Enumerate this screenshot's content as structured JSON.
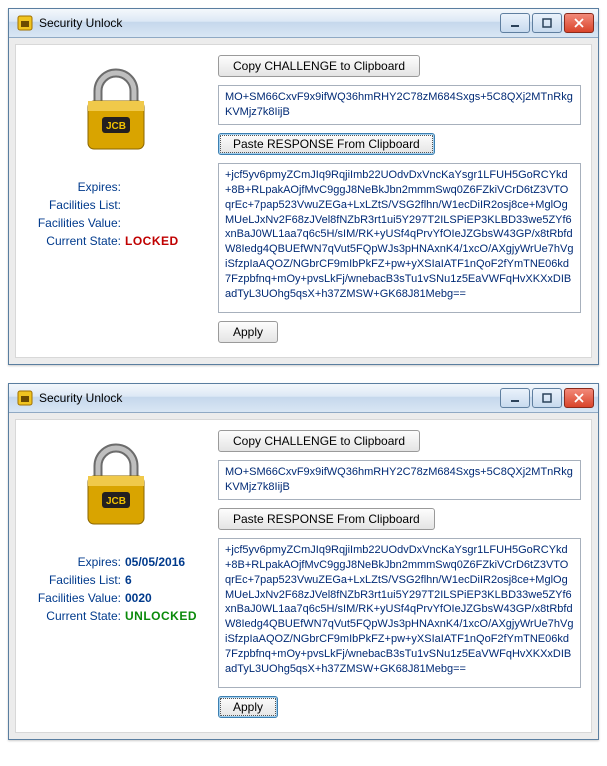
{
  "windows": [
    {
      "title": "Security Unlock",
      "copy_button": "Copy CHALLENGE to Clipboard",
      "paste_button": "Paste RESPONSE From Clipboard",
      "apply_button": "Apply",
      "challenge": "MO+SM66CxvF9x9ifWQ36hmRHY2C78zM684Sxgs+5C8QXj2MTnRkgKVMjz7k8IijB",
      "response": "+jcf5yv6pmyZCmJIq9RqjiImb22UOdvDxVncKaYsgr1LFUH5GoRCYkd+8B+RLpakAOjfMvC9ggJ8NeBkJbn2mmmSwq0Z6FZkiVCrD6tZ3VTOqrEc+7pap523VwuZEGa+LxLZtS/VSG2flhn/W1ecDiIR2osj8ce+MglOgMUeLJxNv2F68zJVel8fNZbR3rt1ui5Y297T2ILSPiEP3KLBD33we5ZYf6xnBaJ0WL1aa7q6c5H/sIM/RK+yUSf4qPrvYfOIeJZGbsW43GP/x8tRbfdW8Iedg4QBUEfWN7qVut5FQpWJs3pHNAxnK4/1xcO/AXgjyWrUe7hVgiSfzpIaAQOZ/NGbrCF9mIbPkFZ+pw+yXSIaIATF1nQoF2fYmTNE06kd7Fzpbfnq+mOy+pvsLkFj/wnebacB3sTu1vSNu1z5EaVWFqHvXKXxDIBadTyL3UOhg5qsX+h37ZMSW+GK68J81Mebg==",
      "labels": {
        "expires": "Expires:",
        "facilities_list": "Facilities List:",
        "facilities_value": "Facilities Value:",
        "current_state": "Current State:"
      },
      "values": {
        "expires": "",
        "facilities_list": "",
        "facilities_value": "",
        "state": "LOCKED"
      },
      "state_class": "state-locked"
    },
    {
      "title": "Security Unlock",
      "copy_button": "Copy CHALLENGE to Clipboard",
      "paste_button": "Paste RESPONSE From Clipboard",
      "apply_button": "Apply",
      "challenge": "MO+SM66CxvF9x9ifWQ36hmRHY2C78zM684Sxgs+5C8QXj2MTnRkgKVMjz7k8IijB",
      "response": "+jcf5yv6pmyZCmJIq9RqjiImb22UOdvDxVncKaYsgr1LFUH5GoRCYkd+8B+RLpakAOjfMvC9ggJ8NeBkJbn2mmmSwq0Z6FZkiVCrD6tZ3VTOqrEc+7pap523VwuZEGa+LxLZtS/VSG2flhn/W1ecDiIR2osj8ce+MglOgMUeLJxNv2F68zJVel8fNZbR3rt1ui5Y297T2ILSPiEP3KLBD33we5ZYf6xnBaJ0WL1aa7q6c5H/sIM/RK+yUSf4qPrvYfOIeJZGbsW43GP/x8tRbfdW8Iedg4QBUEfWN7qVut5FQpWJs3pHNAxnK4/1xcO/AXgjyWrUe7hVgiSfzpIaAQOZ/NGbrCF9mIbPkFZ+pw+yXSIaIATF1nQoF2fYmTNE06kd7Fzpbfnq+mOy+pvsLkFj/wnebacB3sTu1vSNu1z5EaVWFqHvXKXxDIBadTyL3UOhg5qsX+h37ZMSW+GK68J81Mebg==",
      "labels": {
        "expires": "Expires:",
        "facilities_list": "Facilities List:",
        "facilities_value": "Facilities Value:",
        "current_state": "Current State:"
      },
      "values": {
        "expires": "05/05/2016",
        "facilities_list": "6",
        "facilities_value": "0020",
        "state": "UNLOCKED"
      },
      "state_class": "state-unlocked"
    }
  ]
}
